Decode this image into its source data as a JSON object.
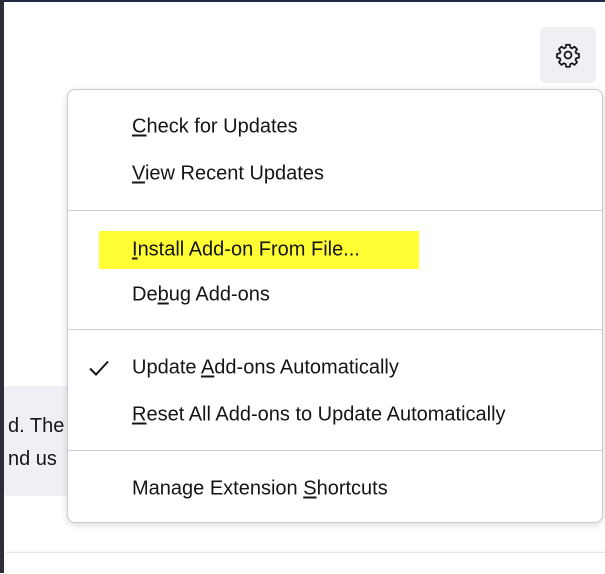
{
  "background": {
    "text_line_1": "d. The",
    "text_line_2": "nd us"
  },
  "toolbar": {
    "gear_icon": "gear-icon"
  },
  "menu": {
    "items": [
      {
        "label": "Check for Updates",
        "access_key": "C"
      },
      {
        "label": "View Recent Updates",
        "access_key": "V"
      },
      {
        "label": "Install Add-on From File...",
        "access_key": "I",
        "highlighted": true,
        "highlight_color": "#ffff33"
      },
      {
        "label": "Debug Add-ons",
        "access_key": "b"
      },
      {
        "label": "Update Add-ons Automatically",
        "access_key": "A",
        "checked": true
      },
      {
        "label": "Reset All Add-ons to Update Automatically",
        "access_key": "R"
      },
      {
        "label": "Manage Extension Shortcuts",
        "access_key": "S"
      }
    ]
  }
}
